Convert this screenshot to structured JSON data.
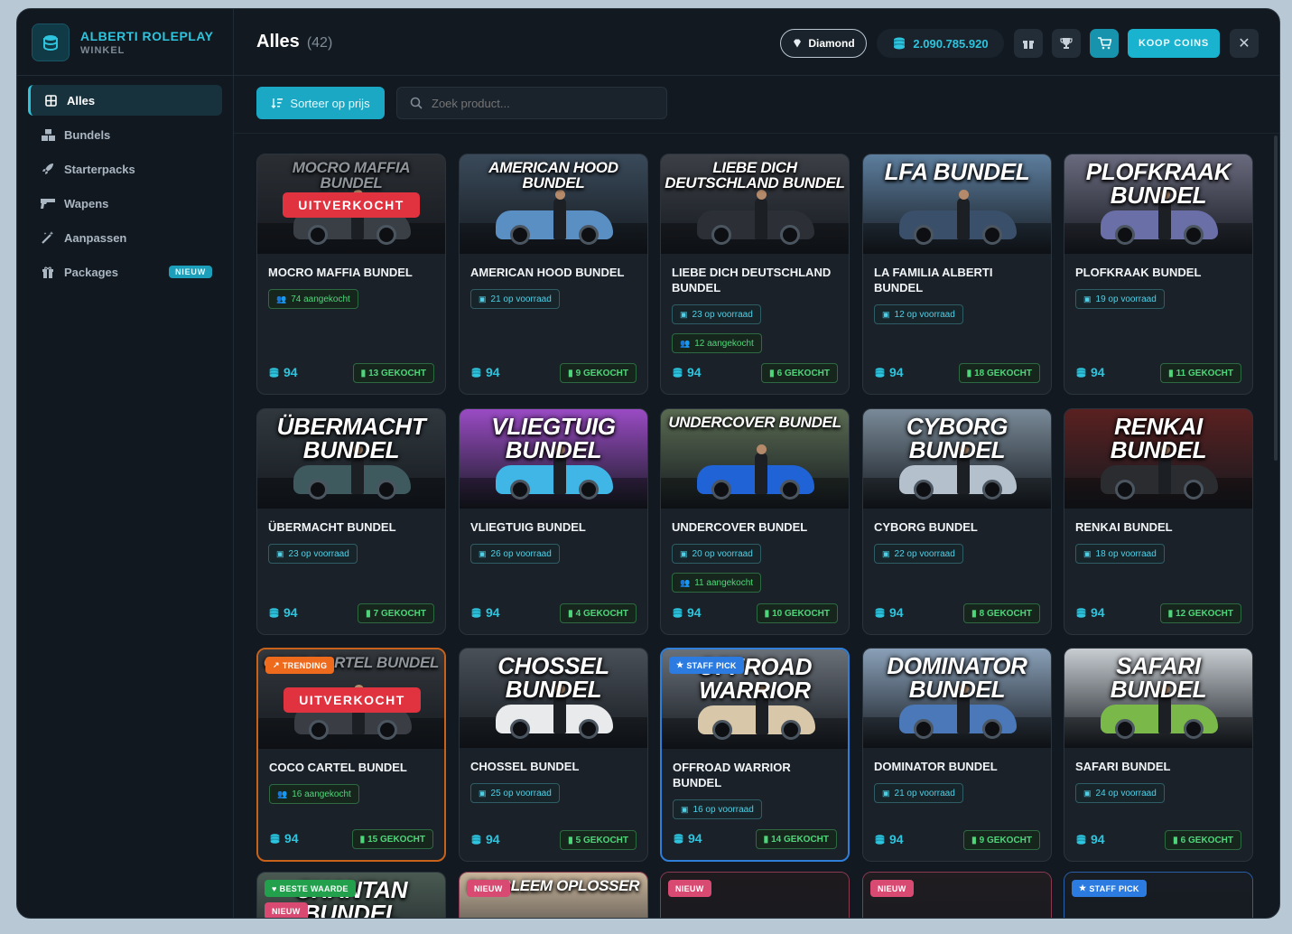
{
  "brand": {
    "title": "ALBERTI ROLEPLAY",
    "subtitle": "WINKEL"
  },
  "nav": [
    {
      "label": "Alles",
      "icon": "grid-icon",
      "active": true
    },
    {
      "label": "Bundels",
      "icon": "boxes-icon"
    },
    {
      "label": "Starterpacks",
      "icon": "rocket-icon"
    },
    {
      "label": "Wapens",
      "icon": "gun-icon"
    },
    {
      "label": "Aanpassen",
      "icon": "magic-wand-icon"
    },
    {
      "label": "Packages",
      "icon": "gift-icon",
      "badge": "NIEUW"
    }
  ],
  "header": {
    "title": "Alles",
    "count": "(42)",
    "rank": "Diamond",
    "balance": "2.090.785.920",
    "buy_coins": "KOOP COINS"
  },
  "toolbar": {
    "sort_label": "Sorteer op prijs",
    "search_placeholder": "Zoek product..."
  },
  "colors": {
    "accent": "#19b2cf",
    "sold_out": "#e1323f",
    "trending": "#ee6a1c",
    "staff_pick": "#2c7be0",
    "best_value": "#22a04c",
    "new": "#d94a73"
  },
  "products": [
    {
      "banner": "MOCRO MAFFIA BUNDEL",
      "name": "MOCRO MAFFIA BUNDEL",
      "sold_out": "UITVERKOCHT",
      "chips": [
        {
          "text": "74 aangekocht",
          "type": "green"
        }
      ],
      "price": "94",
      "sold": "13 GEKOCHT",
      "car": "#3a3f46",
      "bg": "#2b2e33"
    },
    {
      "banner": "AMERICAN HOOD BUNDEL",
      "name": "AMERICAN HOOD BUNDEL",
      "chips": [
        {
          "text": "21 op voorraad",
          "type": "blue"
        }
      ],
      "price": "94",
      "sold": "9 GEKOCHT",
      "car": "#5a8fc4",
      "bg": "#3a4a5a"
    },
    {
      "banner": "LIEBE DICH DEUTSCHLAND BUNDEL",
      "name": "LIEBE DICH DEUTSCHLAND BUNDEL",
      "chips": [
        {
          "text": "23 op voorraad",
          "type": "blue"
        },
        {
          "text": "12 aangekocht",
          "type": "green"
        }
      ],
      "price": "94",
      "sold": "6 GEKOCHT",
      "car": "#2c3036",
      "bg": "#3c4046"
    },
    {
      "banner": "LFA BUNDEL",
      "name": "LA FAMILIA ALBERTI BUNDEL",
      "chips": [
        {
          "text": "12 op voorraad",
          "type": "blue"
        }
      ],
      "price": "94",
      "sold": "18 GEKOCHT",
      "car": "#3a4f6a",
      "bg": "#5d7e9e"
    },
    {
      "banner": "PLOFKRAAK BUNDEL",
      "name": "PLOFKRAAK BUNDEL",
      "chips": [
        {
          "text": "19 op voorraad",
          "type": "blue"
        }
      ],
      "price": "94",
      "sold": "11 GEKOCHT",
      "car": "#6a6fa8",
      "bg": "#6a6a7e"
    },
    {
      "banner": "ÜBERMACHT BUNDEL",
      "name": "ÜBERMACHT BUNDEL",
      "chips": [
        {
          "text": "23 op voorraad",
          "type": "blue"
        }
      ],
      "price": "94",
      "sold": "7 GEKOCHT",
      "car": "#3e5a5e",
      "bg": "#30383e"
    },
    {
      "banner": "VLIEGTUIG BUNDEL",
      "name": "VLIEGTUIG BUNDEL",
      "chips": [
        {
          "text": "26 op voorraad",
          "type": "blue"
        }
      ],
      "price": "94",
      "sold": "4 GEKOCHT",
      "car": "#3fb6e6",
      "bg": "#9a4bc4"
    },
    {
      "banner": "UNDERCOVER BUNDEL",
      "name": "UNDERCOVER BUNDEL",
      "chips": [
        {
          "text": "20 op voorraad",
          "type": "blue"
        },
        {
          "text": "11 aangekocht",
          "type": "green"
        }
      ],
      "price": "94",
      "sold": "10 GEKOCHT",
      "car": "#1f63d6",
      "bg": "#5a6b52"
    },
    {
      "banner": "CYBORG BUNDEL",
      "name": "CYBORG BUNDEL",
      "chips": [
        {
          "text": "22 op voorraad",
          "type": "blue"
        }
      ],
      "price": "94",
      "sold": "8 GEKOCHT",
      "car": "#b4c0cc",
      "bg": "#7a8a98"
    },
    {
      "banner": "RENKAI BUNDEL",
      "name": "RENKAI BUNDEL",
      "chips": [
        {
          "text": "18 op voorraad",
          "type": "blue"
        }
      ],
      "price": "94",
      "sold": "12 GEKOCHT",
      "car": "#2a2c30",
      "bg": "#5a2020"
    },
    {
      "banner": "COCO CARTEL BUNDEL",
      "name": "COCO CARTEL BUNDEL",
      "tag": {
        "text": "TRENDING",
        "type": "trend"
      },
      "sold_out": "UITVERKOCHT",
      "chips": [
        {
          "text": "16 aangekocht",
          "type": "green"
        }
      ],
      "price": "94",
      "sold": "15 GEKOCHT",
      "car": "#3a3e44",
      "bg": "#34383d",
      "border": "orange"
    },
    {
      "banner": "CHOSSEL BUNDEL",
      "name": "CHOSSEL BUNDEL",
      "chips": [
        {
          "text": "25 op voorraad",
          "type": "blue"
        }
      ],
      "price": "94",
      "sold": "5 GEKOCHT",
      "car": "#e8eaec",
      "bg": "#4a5058"
    },
    {
      "banner": "OFFROAD WARRIOR",
      "name": "OFFROAD WARRIOR BUNDEL",
      "tag": {
        "text": "STAFF PICK",
        "type": "staff"
      },
      "chips": [
        {
          "text": "16 op voorraad",
          "type": "blue"
        }
      ],
      "price": "94",
      "sold": "14 GEKOCHT",
      "car": "#d8c7a8",
      "bg": "#6a7078",
      "border": "blue"
    },
    {
      "banner": "DOMINATOR BUNDEL",
      "name": "DOMINATOR BUNDEL",
      "chips": [
        {
          "text": "21 op voorraad",
          "type": "blue"
        }
      ],
      "price": "94",
      "sold": "9 GEKOCHT",
      "car": "#4a78b8",
      "bg": "#8aa0b8"
    },
    {
      "banner": "SAFARI BUNDEL",
      "name": "SAFARI BUNDEL",
      "chips": [
        {
          "text": "24 op voorraad",
          "type": "blue"
        }
      ],
      "price": "94",
      "sold": "6 GEKOCHT",
      "car": "#7bb84a",
      "bg": "#c8cdd2"
    },
    {
      "banner": "CHANTAN BUNDEL",
      "tag": {
        "text": "BESTE WAARDE",
        "type": "best"
      },
      "tag2": {
        "text": "NIEUW",
        "type": "new"
      },
      "bg": "#4a5a52"
    },
    {
      "banner": "PROBLEEM OPLOSSER",
      "tag": {
        "text": "NIEUW",
        "type": "new"
      },
      "bg": "#c8b49a",
      "border": "pink"
    },
    {
      "tag": {
        "text": "NIEUW",
        "type": "new"
      },
      "bg": "#1e1a1e",
      "border": "pink"
    },
    {
      "tag": {
        "text": "NIEUW",
        "type": "new"
      },
      "bg": "#201c20",
      "border": "pink"
    },
    {
      "tag": {
        "text": "STAFF PICK",
        "type": "staff"
      },
      "bg": "#181d24",
      "border": "blue2"
    }
  ]
}
